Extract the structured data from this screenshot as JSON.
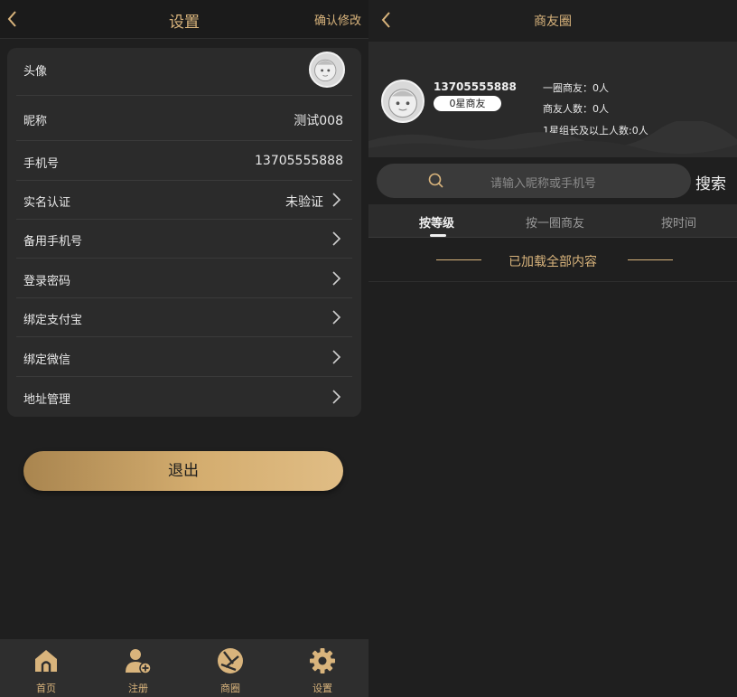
{
  "settings": {
    "title": "设置",
    "confirm_label": "确认修改",
    "rows": [
      {
        "label": "头像",
        "value": ""
      },
      {
        "label": "昵称",
        "value": "测试008"
      },
      {
        "label": "手机号",
        "value": "13705555888"
      },
      {
        "label": "实名认证",
        "value": "未验证"
      },
      {
        "label": "备用手机号",
        "value": ""
      },
      {
        "label": "登录密码",
        "value": ""
      },
      {
        "label": "绑定支付宝",
        "value": ""
      },
      {
        "label": "绑定微信",
        "value": ""
      },
      {
        "label": "地址管理",
        "value": ""
      }
    ],
    "logout_label": "退出"
  },
  "tabbar": {
    "items": [
      {
        "label": "首页",
        "icon": "home-icon"
      },
      {
        "label": "注册",
        "icon": "add-user-icon"
      },
      {
        "label": "商圈",
        "icon": "aperture-icon"
      },
      {
        "label": "设置",
        "icon": "gear-icon"
      }
    ]
  },
  "circle": {
    "title": "商友圈",
    "phone": "13705555888",
    "star_level": "0星商友",
    "stats": [
      "一圈商友：0人",
      "商友人数：0人",
      "1星组长及以上人数:0人"
    ],
    "search": {
      "placeholder": "请输入昵称或手机号",
      "button": "搜索"
    },
    "sort_tabs": [
      "按等级",
      "按一圈商友",
      "按时间"
    ],
    "active_sort": "按等级",
    "loaded_text": "已加载全部内容"
  },
  "colors": {
    "accent": "#d9b47c",
    "background": "#1f1f1f",
    "card": "#2b2b2b"
  }
}
